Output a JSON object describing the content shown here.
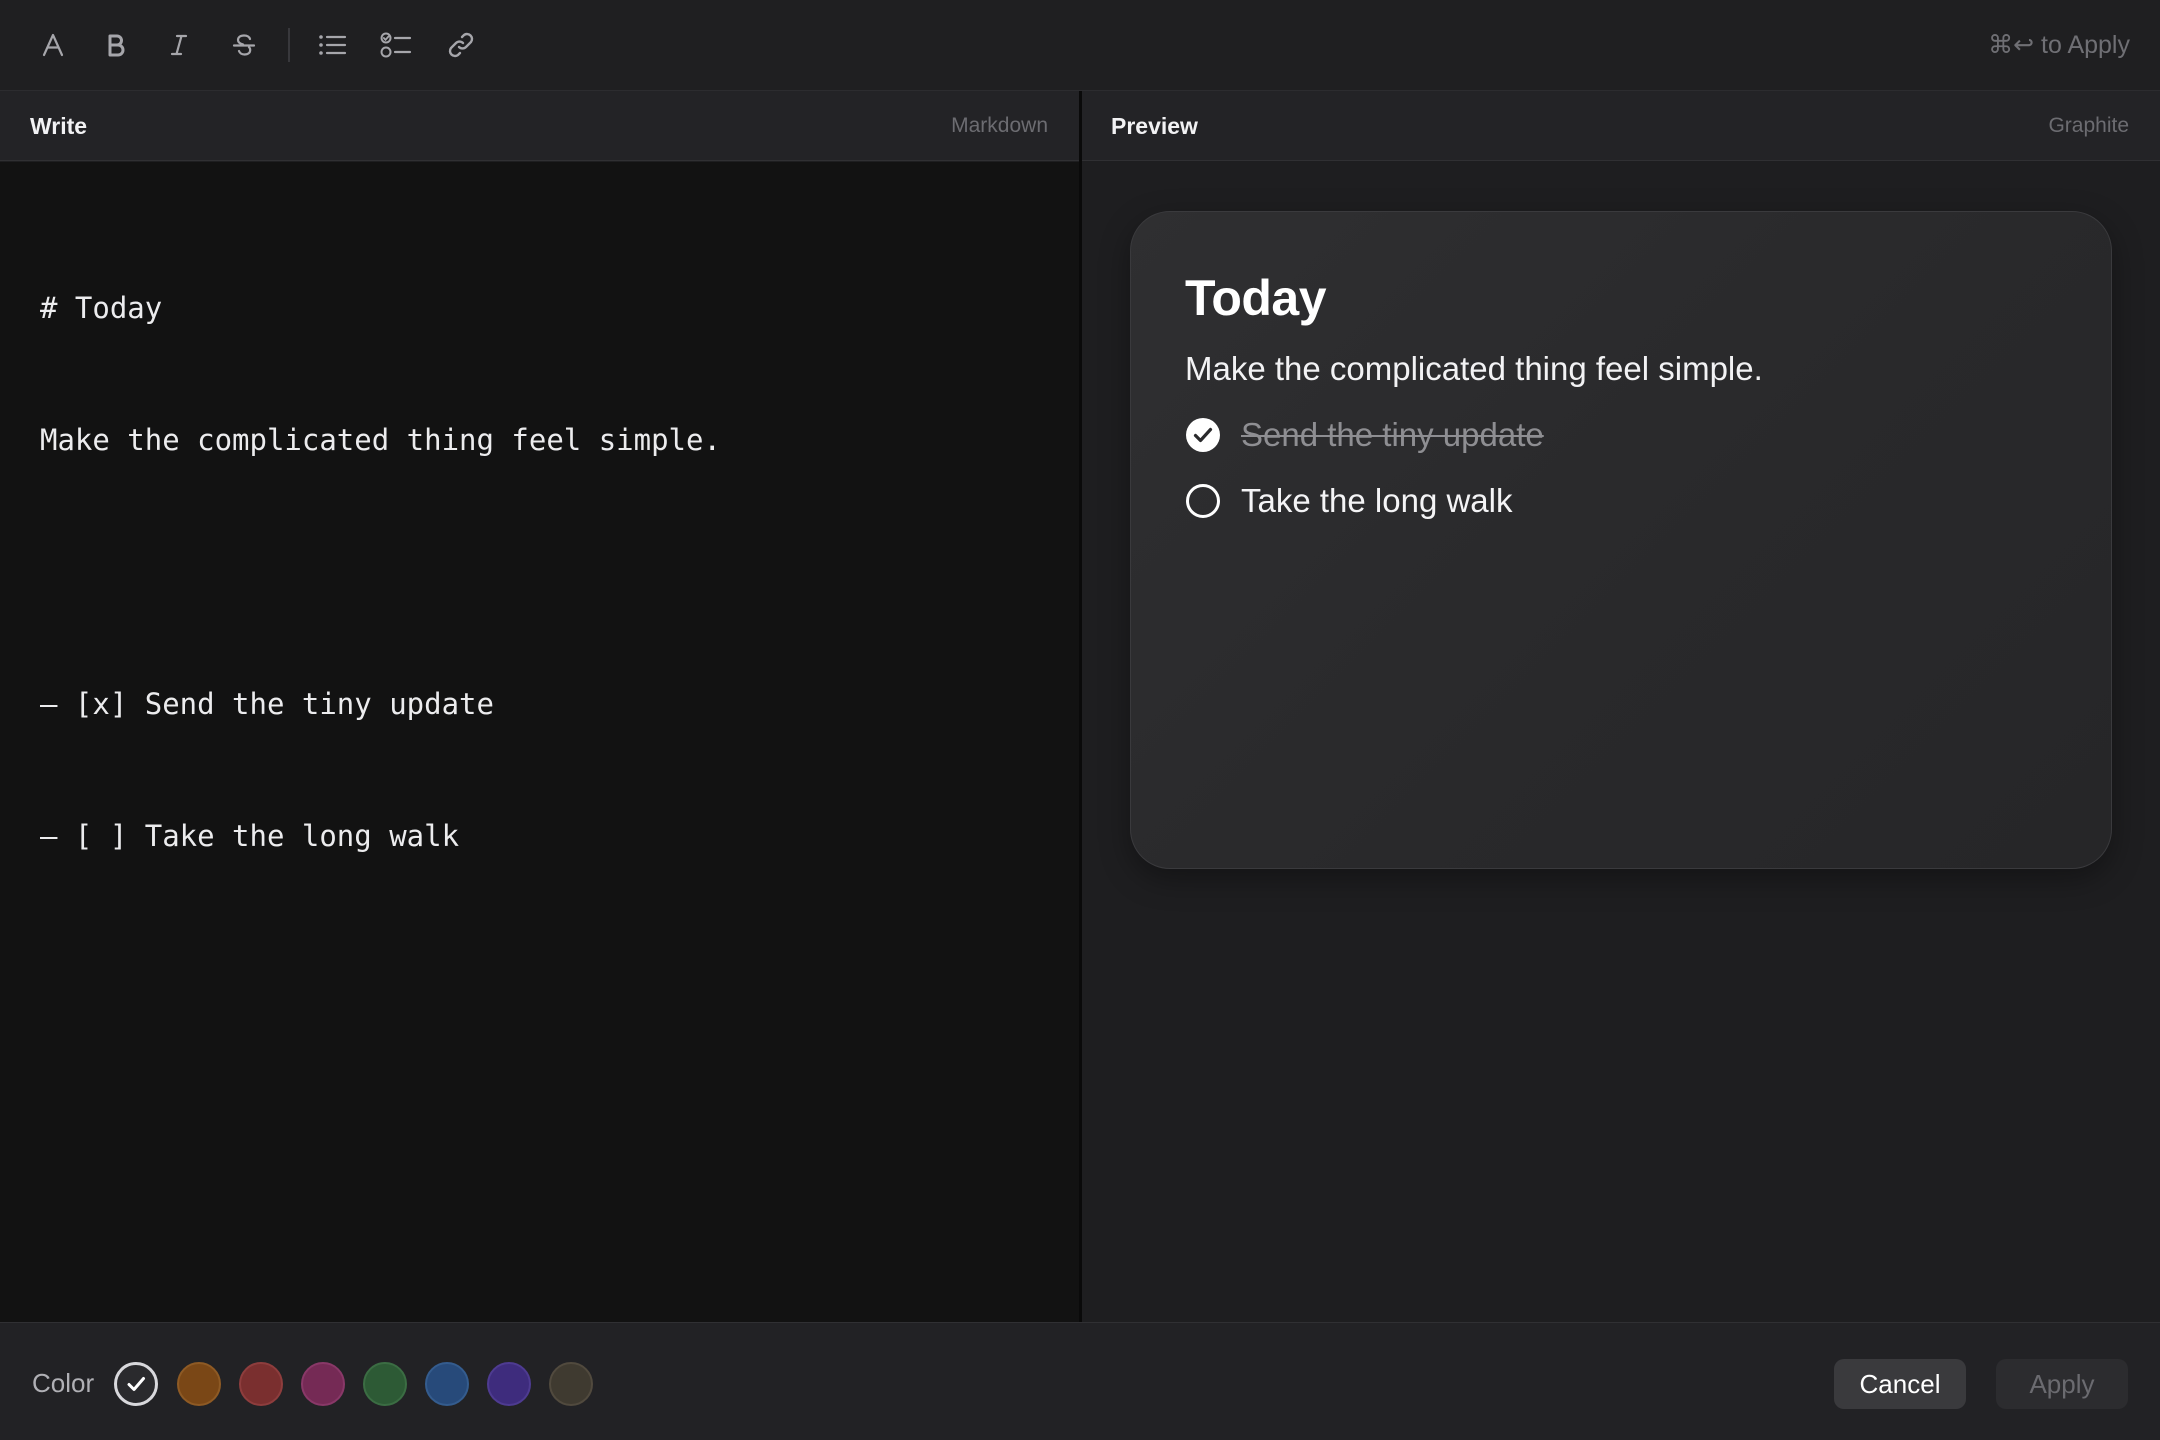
{
  "toolbar": {
    "tools": [
      {
        "name": "text-style",
        "icon": "font-a-icon"
      },
      {
        "name": "bold",
        "icon": "bold-icon"
      },
      {
        "name": "italic",
        "icon": "italic-icon"
      },
      {
        "name": "strikethrough",
        "icon": "strikethrough-icon"
      },
      {
        "name": "bullet-list",
        "icon": "bullet-list-icon"
      },
      {
        "name": "checklist",
        "icon": "checklist-icon"
      },
      {
        "name": "link",
        "icon": "link-icon"
      }
    ],
    "shortcut_hint": "⌘↩ to Apply"
  },
  "write_pane": {
    "title": "Write",
    "mode": "Markdown",
    "lines": [
      "# Today",
      "Make the complicated thing feel simple.",
      "",
      "– [x] Send the tiny update",
      "– [ ] Take the long walk"
    ]
  },
  "preview_pane": {
    "title": "Preview",
    "theme": "Graphite",
    "card": {
      "heading": "Today",
      "subtitle": "Make the complicated thing feel simple.",
      "tasks": [
        {
          "text": "Send the tiny update",
          "done": true
        },
        {
          "text": "Take the long walk",
          "done": false
        }
      ]
    }
  },
  "footer": {
    "color_label": "Color",
    "swatches": [
      {
        "name": "default",
        "color": "#2a2a2d",
        "selected": true
      },
      {
        "name": "orange",
        "color": "#7a4716",
        "selected": false
      },
      {
        "name": "red",
        "color": "#7a2f2f",
        "selected": false
      },
      {
        "name": "pink",
        "color": "#752a55",
        "selected": false
      },
      {
        "name": "green",
        "color": "#2d5a35",
        "selected": false
      },
      {
        "name": "blue",
        "color": "#274a7a",
        "selected": false
      },
      {
        "name": "purple",
        "color": "#3e2c7d",
        "selected": false
      },
      {
        "name": "brown",
        "color": "#3f3a30",
        "selected": false
      }
    ],
    "cancel_label": "Cancel",
    "apply_label": "Apply"
  }
}
